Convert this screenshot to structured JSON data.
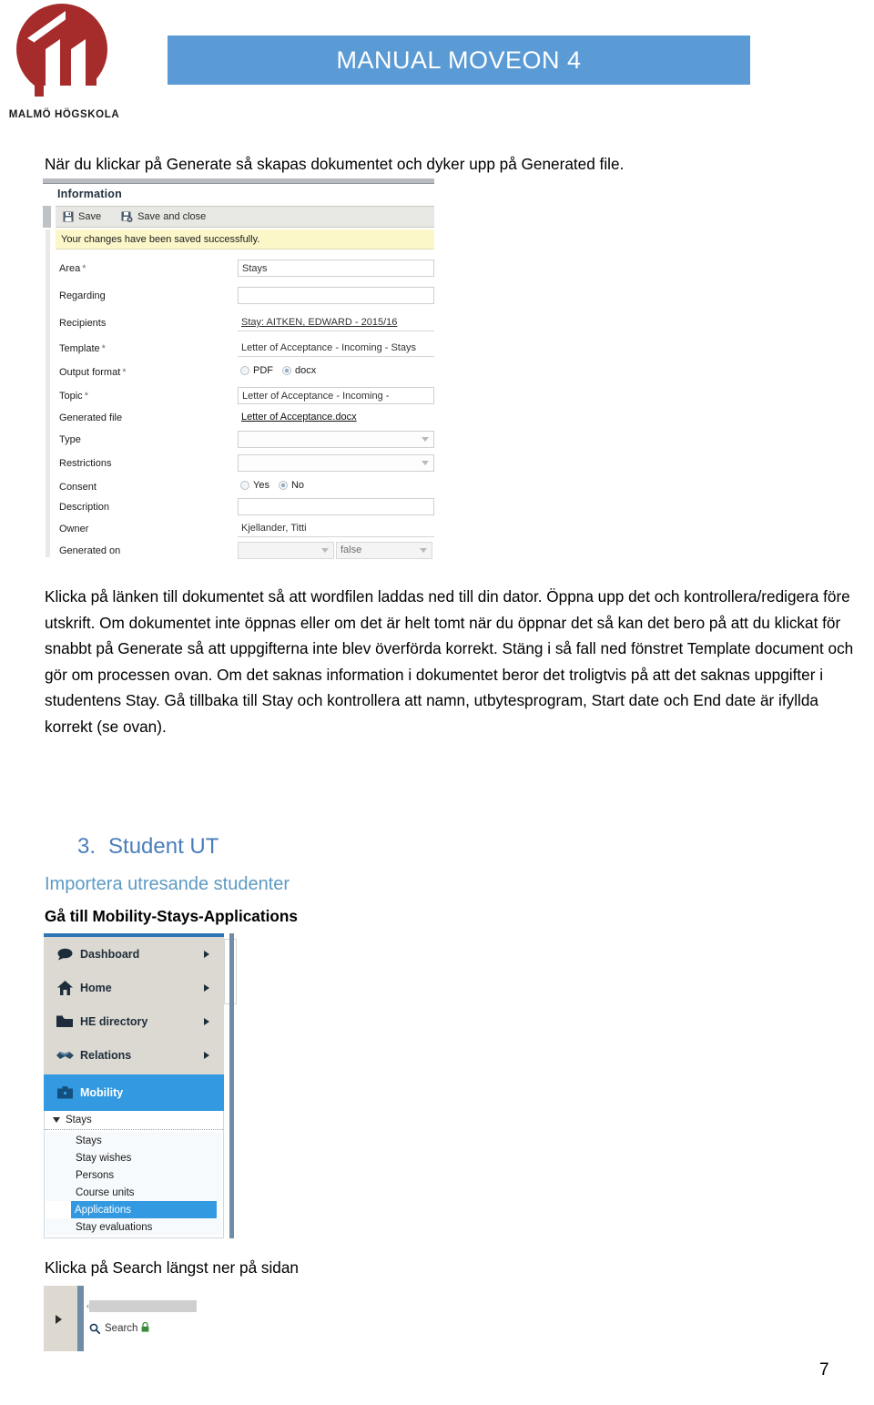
{
  "header": {
    "logo_name": "malmo-hogskola-logo",
    "logo_caption": "MALMÖ HÖGSKOLA",
    "banner_title": "MANUAL MOVEON 4",
    "banner_color": "#5b9bd5",
    "logo_color": "#a62b2b"
  },
  "body": {
    "intro_line": "När du klickar på Generate så skapas dokumentet och dyker upp på Generated file.",
    "paragraph": "Klicka på länken till dokumentet så att wordfilen laddas ned till din dator. Öppna upp det och kontrollera/redigera före utskrift. Om dokumentet inte öppnas eller om det är helt tomt när du öppnar det så kan det bero på att du klickat för snabbt på Generate så att uppgifterna inte blev överförda korrekt. Stäng i så fall ned fönstret Template document och gör om processen ovan. Om det saknas information i dokumentet beror det troligtvis på att det saknas uppgifter i studentens Stay. Gå tillbaka till Stay och kontrollera att namn, utbytesprogram, Start date och End date är ifyllda korrekt (se ovan).",
    "section_number": "3.",
    "section_title": "Student UT",
    "section_subtitle": "Importera utresande studenter",
    "nav_caption": "Gå till Mobility-Stays-Applications",
    "search_caption": "Klicka på Search längst ner på sidan",
    "page_number": "7"
  },
  "form_screenshot": {
    "panel_title": "Information",
    "toolbar": [
      {
        "label": "Save",
        "icon": "save-icon"
      },
      {
        "label": "Save and close",
        "icon": "save-and-close-icon"
      }
    ],
    "alert_message": "Your changes have been saved successfully.",
    "alert_color": "#fbf7c9",
    "fields": [
      {
        "label": "Area",
        "required": true,
        "type": "text",
        "value": "Stays"
      },
      {
        "label": "Regarding",
        "required": false,
        "type": "text",
        "value": ""
      },
      {
        "label": "Recipients",
        "required": false,
        "type": "link",
        "value": "Stay: AITKEN, EDWARD - 2015/16"
      },
      {
        "label": "Template",
        "required": true,
        "type": "text",
        "value": "Letter of Acceptance - Incoming - Stays"
      },
      {
        "label": "Output format",
        "required": true,
        "type": "radio",
        "options": [
          "PDF",
          "docx"
        ],
        "selected": "docx"
      },
      {
        "label": "Topic",
        "required": true,
        "type": "text",
        "value": "Letter of Acceptance - Incoming -"
      },
      {
        "label": "Generated file",
        "required": false,
        "type": "filelink",
        "value": "Letter of Acceptance.docx"
      },
      {
        "label": "Type",
        "required": false,
        "type": "select",
        "value": ""
      },
      {
        "label": "Restrictions",
        "required": false,
        "type": "select",
        "value": ""
      },
      {
        "label": "Consent",
        "required": false,
        "type": "radio",
        "options": [
          "Yes",
          "No"
        ],
        "selected": "No"
      },
      {
        "label": "Description",
        "required": false,
        "type": "text",
        "value": ""
      },
      {
        "label": "Owner",
        "required": false,
        "type": "text",
        "value": "Kjellander, Titti"
      },
      {
        "label": "Generated on",
        "required": false,
        "type": "split",
        "value_left": "",
        "value_right": "false"
      }
    ],
    "annotation": {
      "shape": "ellipse",
      "color": "#a02c2c"
    }
  },
  "nav_screenshot": {
    "items": [
      {
        "label": "Dashboard",
        "icon": "speech-bubble-icon",
        "has_arrow": true,
        "active": false
      },
      {
        "label": "Home",
        "icon": "house-icon",
        "has_arrow": true,
        "active": false
      },
      {
        "label": "HE directory",
        "icon": "folder-icon",
        "has_arrow": true,
        "active": false
      },
      {
        "label": "Relations",
        "icon": "handshake-icon",
        "has_arrow": true,
        "active": false
      },
      {
        "label": "Mobility",
        "icon": "briefcase-icon",
        "has_arrow": false,
        "active": true
      }
    ],
    "submenu_header": "Stays",
    "submenu_items": [
      {
        "label": "Stays",
        "selected": false
      },
      {
        "label": "Stay wishes",
        "selected": false
      },
      {
        "label": "Persons",
        "selected": false
      },
      {
        "label": "Course units",
        "selected": false
      },
      {
        "label": "Applications",
        "selected": true
      },
      {
        "label": "Stay evaluations",
        "selected": false
      }
    ],
    "active_color": "#3399e0"
  },
  "search_screenshot": {
    "search_label": "Search",
    "search_icon": "magnifier-icon",
    "lock_icon": "lock-icon",
    "expand_icon": "right-arrow-icon",
    "collapse_icon": "left-chevron-icon"
  }
}
